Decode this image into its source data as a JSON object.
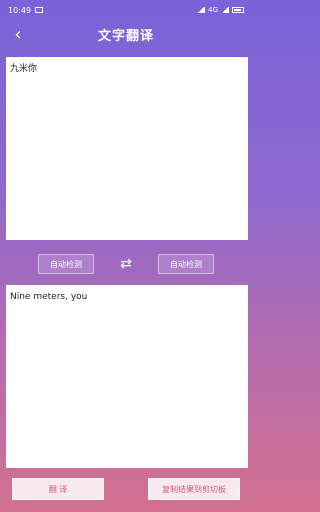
{
  "status": {
    "time": "10:49",
    "right_text": "4G"
  },
  "header": {
    "title": "文字翻译",
    "back_icon": "chevron-left-icon"
  },
  "input": {
    "text": "九米你"
  },
  "lang": {
    "source": "自动检测",
    "target": "自动检测",
    "swap_icon": "swap-arrows-icon"
  },
  "output": {
    "text": "Nine meters, you"
  },
  "actions": {
    "translate": "翻 译",
    "copy": "复制结果到剪切板"
  }
}
